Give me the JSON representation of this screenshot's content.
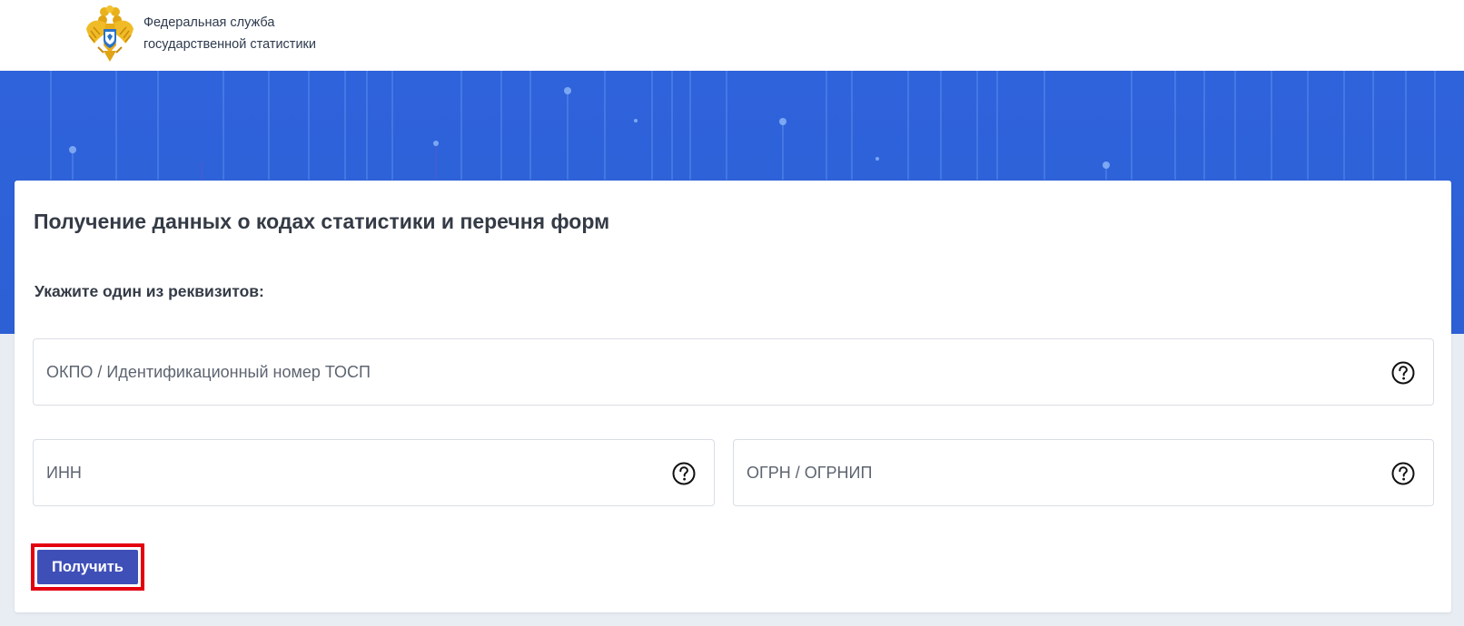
{
  "header": {
    "org_line1": "Федеральная служба",
    "org_line2": "государственной статистики",
    "logo_icon": "double-headed-eagle-emblem"
  },
  "form": {
    "title": "Получение данных о кодах статистики и перечня форм",
    "subtitle": "Укажите один из реквизитов:",
    "fields": {
      "okpo": {
        "placeholder": "ОКПО / Идентификационный номер ТОСП",
        "value": "",
        "icon": "question-circle-icon"
      },
      "inn": {
        "placeholder": "ИНН",
        "value": "",
        "icon": "question-circle-icon"
      },
      "ogrn": {
        "placeholder": "ОГРН / ОГРНИП",
        "value": "",
        "icon": "question-circle-icon"
      }
    },
    "submit_label": "Получить"
  },
  "colors": {
    "banner": "#2e63d9",
    "button": "#3f4fb8",
    "highlight": "#e3000f",
    "text": "#343b46"
  }
}
